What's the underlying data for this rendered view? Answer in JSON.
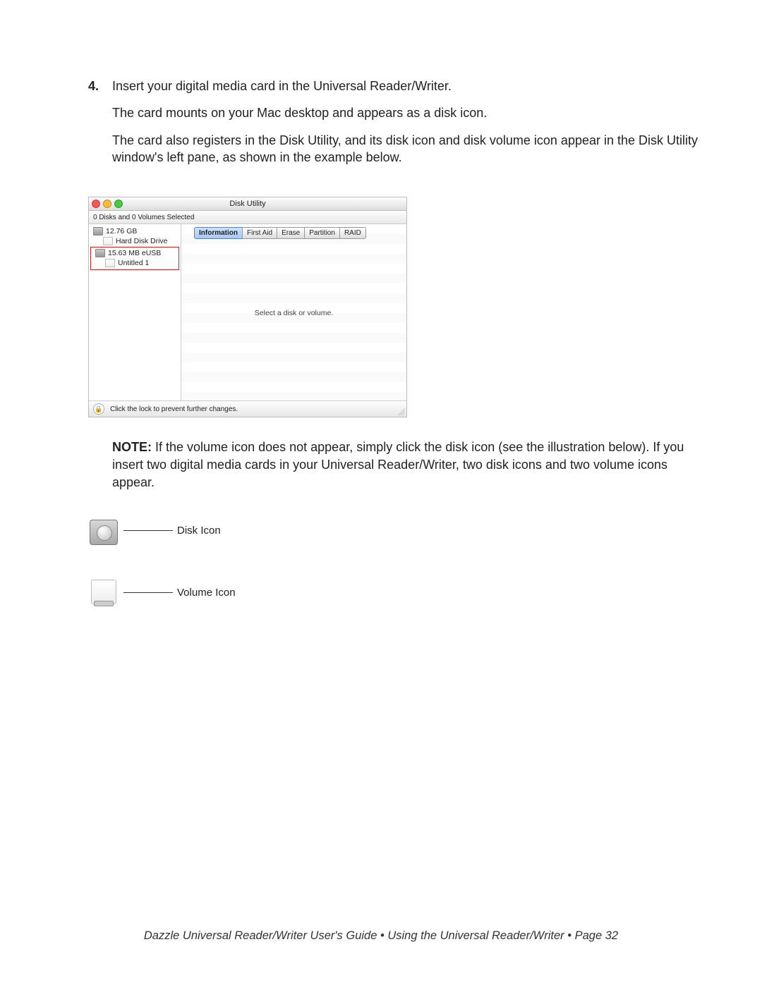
{
  "step": {
    "number": "4.",
    "line1": "Insert your digital media card in the Universal Reader/Writer.",
    "line2": "The card mounts on your Mac desktop and appears as a disk icon.",
    "line3": "The card also registers in the Disk Utility, and its disk icon and disk volume icon appear in the Disk Utility window's left pane, as shown in the example below."
  },
  "screenshot": {
    "title": "Disk Utility",
    "subheader": "0 Disks and 0 Volumes Selected",
    "sidebar": {
      "disk1": "12.76 GB",
      "disk1_vol": "Hard Disk Drive",
      "disk2": "15.63 MB eUSB",
      "disk2_vol": "Untitled 1"
    },
    "tabs": [
      "Information",
      "First Aid",
      "Erase",
      "Partition",
      "RAID"
    ],
    "message": "Select a disk or volume.",
    "footer": "Click the lock to prevent further changes."
  },
  "note": {
    "label": "NOTE:",
    "text": "If the volume icon does not appear, simply click the disk icon (see the illustration below). If you insert two digital media cards in your Universal Reader/Writer, two disk icons and two volume icons appear."
  },
  "callouts": {
    "disk": "Disk Icon",
    "volume": "Volume Icon"
  },
  "page_footer": "Dazzle  Universal Reader/Writer User's Guide • Using the Universal Reader/Writer • Page 32"
}
